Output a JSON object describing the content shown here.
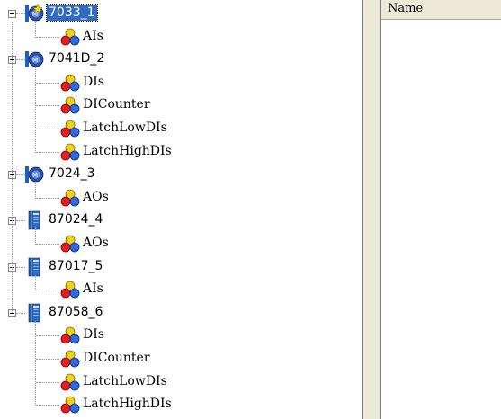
{
  "tree": {
    "devices": [
      {
        "id": "7033_1",
        "label": "7033_1",
        "icon": "device-blue-star-icon",
        "selected": true,
        "channels": [
          "AIs"
        ]
      },
      {
        "id": "7041D_2",
        "label": "7041D_2",
        "icon": "device-blue-icon",
        "selected": false,
        "channels": [
          "DIs",
          "DICounter",
          "LatchLowDIs",
          "LatchHighDIs"
        ]
      },
      {
        "id": "7024_3",
        "label": "7024_3",
        "icon": "device-blue-icon",
        "selected": false,
        "channels": [
          "AOs"
        ]
      },
      {
        "id": "87024_4",
        "label": "87024_4",
        "icon": "module-tower-icon",
        "selected": false,
        "channels": [
          "AOs"
        ]
      },
      {
        "id": "87017_5",
        "label": "87017_5",
        "icon": "module-tower-icon",
        "selected": false,
        "channels": [
          "AIs"
        ]
      },
      {
        "id": "87058_6",
        "label": "87058_6",
        "icon": "module-tower-icon",
        "selected": false,
        "channels": [
          "DIs",
          "DICounter",
          "LatchLowDIs",
          "LatchHighDIs"
        ]
      }
    ]
  },
  "list": {
    "column_name": "Name"
  },
  "colors": {
    "selection": "#316ac5",
    "pane_chrome": "#ece9d8"
  }
}
